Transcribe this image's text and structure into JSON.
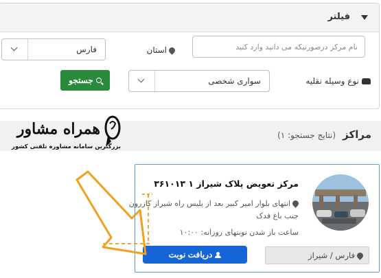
{
  "filter": {
    "title": "فیلتر",
    "search_placeholder": "نام مرکز درصورتیکه می دانید وارد کنید",
    "province_label": "استان",
    "province_value": "فارس",
    "vehicle_label": "نوع وسیله نقلیه",
    "vehicle_value": "سواری شخصی",
    "search_button": "جستجو"
  },
  "centers": {
    "title": "مراکز",
    "result_count": "(نتایج جستجو: ۱)"
  },
  "logo": {
    "name": "همراه مشاور",
    "tagline": "بزرگترین سامانه مشاوره تلفنی کشور"
  },
  "center_card": {
    "title": "مرکز تعویض پلاک شیراز ۱ ۳۶۱۰۱۳",
    "address": "انتهای بلوار امیر کبیر بعد از پلیس راه شیراز کازرون جنب باغ فدک",
    "hours": "ساعت باز شدن نوبتهای روزانه: ۱۰:۰۰",
    "location": "فارس / شیراز",
    "book_button": "دریافت نوبت"
  },
  "colors": {
    "search_button": "#2a8a3b",
    "book_button": "#1565d8",
    "card_border": "#5a9bd5",
    "annotation_arrow": "#f0a01e"
  },
  "icons": [
    "caret-down-icon",
    "map-pin-icon",
    "car-icon",
    "search-icon",
    "user-icon",
    "chevron-down-icon"
  ]
}
